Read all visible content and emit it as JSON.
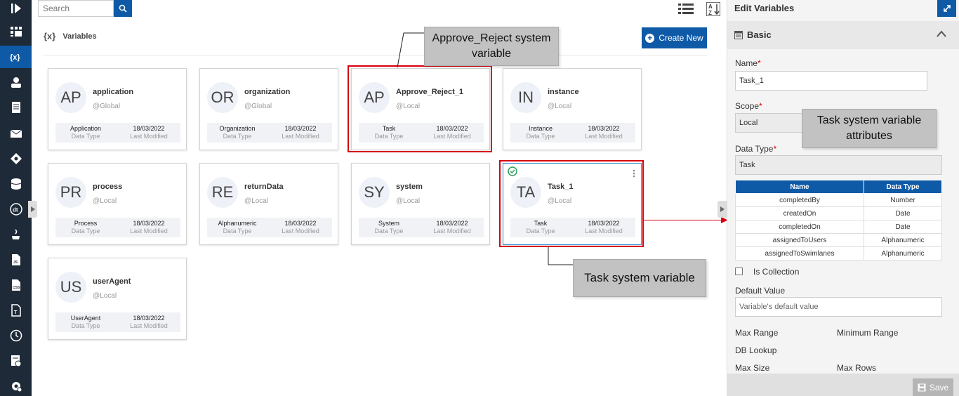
{
  "search": {
    "placeholder": "Search"
  },
  "header": {
    "icon_text": "{x}",
    "title": "Variables",
    "create_label": "Create New"
  },
  "sidebar": {
    "items": [
      "logo-icon",
      "dashboard-icon",
      "variables-icon",
      "user-icon",
      "document-icon",
      "mail-icon",
      "diamond-icon",
      "database-icon",
      "dt-icon",
      "java-icon",
      "file-icon",
      "file-code-icon",
      "template-icon",
      "clock-icon",
      "report-icon",
      "settings-icon"
    ]
  },
  "variables": [
    {
      "initials": "AP",
      "name": "application",
      "scope": "@Global",
      "type": "Application",
      "type_label": "Data Type",
      "date": "18/03/2022",
      "date_label": "Last Modified"
    },
    {
      "initials": "OR",
      "name": "organization",
      "scope": "@Global",
      "type": "Organization",
      "type_label": "Data Type",
      "date": "18/03/2022",
      "date_label": "Last Modified"
    },
    {
      "initials": "AP",
      "name": "Approve_Reject_1",
      "scope": "@Local",
      "type": "Task",
      "type_label": "Data Type",
      "date": "18/03/2022",
      "date_label": "Last Modified"
    },
    {
      "initials": "IN",
      "name": "instance",
      "scope": "@Local",
      "type": "Instance",
      "type_label": "Data Type",
      "date": "18/03/2022",
      "date_label": "Last Modified"
    },
    {
      "initials": "PR",
      "name": "process",
      "scope": "@Local",
      "type": "Process",
      "type_label": "Data Type",
      "date": "18/03/2022",
      "date_label": "Last Modified"
    },
    {
      "initials": "RE",
      "name": "returnData",
      "scope": "@Local",
      "type": "Alphanumeric",
      "type_label": "Data Type",
      "date": "18/03/2022",
      "date_label": "Last Modified"
    },
    {
      "initials": "SY",
      "name": "system",
      "scope": "@Local",
      "type": "System",
      "type_label": "Data Type",
      "date": "18/03/2022",
      "date_label": "Last Modified"
    },
    {
      "initials": "TA",
      "name": "Task_1",
      "scope": "@Local",
      "type": "Task",
      "type_label": "Data Type",
      "date": "18/03/2022",
      "date_label": "Last Modified"
    },
    {
      "initials": "US",
      "name": "userAgent",
      "scope": "@Local",
      "type": "UserAgent",
      "type_label": "Data Type",
      "date": "18/03/2022",
      "date_label": "Last Modified"
    }
  ],
  "callouts": {
    "approve": "Approve_Reject system variable",
    "task_attr": "Task system variable attributes",
    "task_var": "Task system variable"
  },
  "panel": {
    "title": "Edit Variables",
    "section": "Basic",
    "name_label": "Name",
    "name_value": "Task_1",
    "scope_label": "Scope",
    "scope_value": "Local",
    "data_type_label": "Data Type",
    "data_type_value": "Task",
    "req_mark": "*",
    "attr_headers": [
      "Name",
      "Data Type"
    ],
    "attributes": [
      [
        "completedBy",
        "Number"
      ],
      [
        "createdOn",
        "Date"
      ],
      [
        "completedOn",
        "Date"
      ],
      [
        "assignedToUsers",
        "Alphanumeric"
      ],
      [
        "assignedToSwimlanes",
        "Alphanumeric"
      ]
    ],
    "collection_label": "Is Collection",
    "default_label": "Default Value",
    "default_placeholder": "Variable's default value",
    "max_range": "Max Range",
    "min_range": "Minimum Range",
    "db_lookup": "DB Lookup",
    "max_size": "Max Size",
    "max_rows": "Max Rows",
    "save_label": "Save"
  },
  "colors": {
    "accent": "#0f5aa7",
    "sidebar": "#1e2a38",
    "highlight": "#d9000d",
    "callout": "#c2c2c2",
    "check": "#2e9e5b"
  }
}
